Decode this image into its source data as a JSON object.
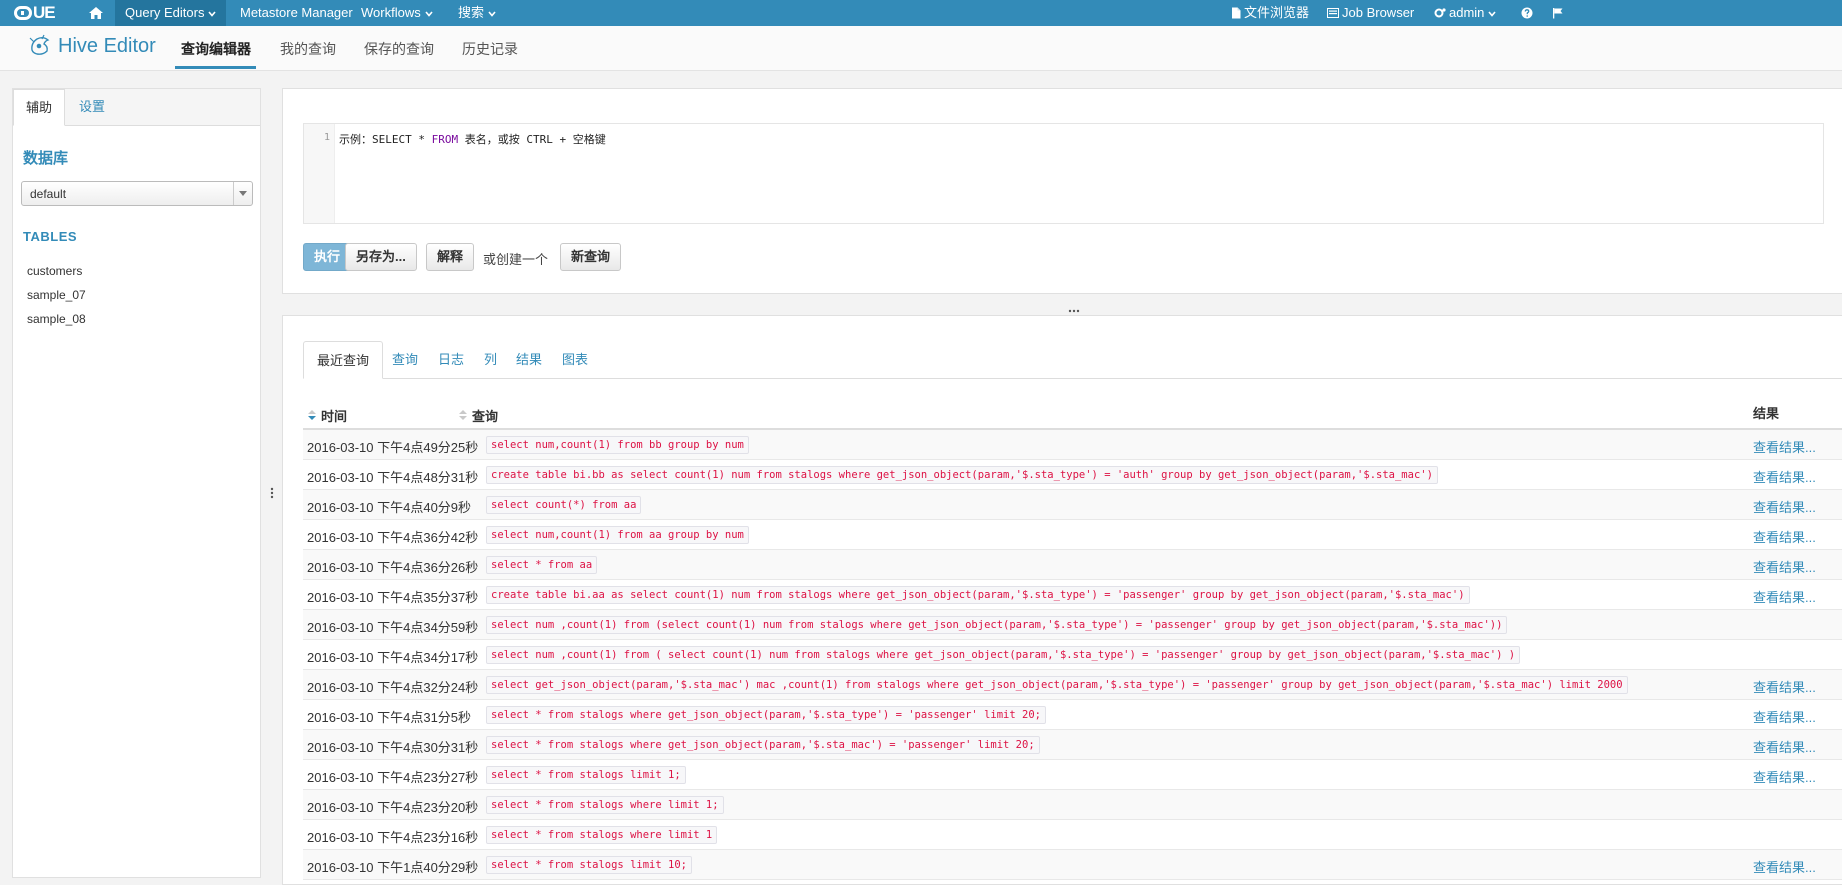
{
  "topnav": {
    "logo_text": "UE",
    "items": [
      {
        "label": "Query Editors"
      },
      {
        "label": "Metastore Manager"
      },
      {
        "label": "Workflows"
      },
      {
        "label": "搜索"
      }
    ],
    "right_items": [
      {
        "label": "文件浏览器"
      },
      {
        "label": "Job Browser"
      },
      {
        "label": "admin"
      }
    ]
  },
  "subheader": {
    "app_title": "Hive Editor",
    "tabs": [
      {
        "label": "查询编辑器"
      },
      {
        "label": "我的查询"
      },
      {
        "label": "保存的查询"
      },
      {
        "label": "历史记录"
      }
    ]
  },
  "left_panel": {
    "tabs": [
      {
        "label": "辅助"
      },
      {
        "label": "设置"
      }
    ],
    "database_label": "数据库",
    "database_selected": "default",
    "tables_label": "TABLES",
    "tables": [
      "customers",
      "sample_07",
      "sample_08"
    ]
  },
  "editor": {
    "line_number": "1",
    "code_prefix": "示例：SELECT * ",
    "code_keyword": "FROM",
    "code_suffix": " 表名，或按 CTRL + 空格键",
    "buttons": {
      "execute": "执行",
      "save_as": "另存为...",
      "explain": "解释",
      "or_create": "或创建一个",
      "new_query": "新查询"
    }
  },
  "results": {
    "tabs": [
      {
        "label": "最近查询"
      },
      {
        "label": "查询"
      },
      {
        "label": "日志"
      },
      {
        "label": "列"
      },
      {
        "label": "结果"
      },
      {
        "label": "图表"
      }
    ],
    "columns": {
      "time": "时间",
      "query": "查询",
      "result": "结果"
    },
    "rows": [
      {
        "time": "2016-03-10 下午4点49分25秒",
        "query": "select num,count(1) from bb group by num",
        "result": "查看结果..."
      },
      {
        "time": "2016-03-10 下午4点48分31秒",
        "query": "create table bi.bb as select count(1) num from stalogs where get_json_object(param,'$.sta_type') = 'auth' group by get_json_object(param,'$.sta_mac')",
        "result": "查看结果..."
      },
      {
        "time": "2016-03-10 下午4点40分9秒",
        "query": "select count(*) from aa",
        "result": "查看结果..."
      },
      {
        "time": "2016-03-10 下午4点36分42秒",
        "query": "select num,count(1) from aa group by num",
        "result": "查看结果..."
      },
      {
        "time": "2016-03-10 下午4点36分26秒",
        "query": "select * from aa",
        "result": "查看结果..."
      },
      {
        "time": "2016-03-10 下午4点35分37秒",
        "query": "create table bi.aa as select count(1) num from stalogs where get_json_object(param,'$.sta_type') = 'passenger' group by get_json_object(param,'$.sta_mac')",
        "result": "查看结果..."
      },
      {
        "time": "2016-03-10 下午4点34分59秒",
        "query": "select num ,count(1) from (select count(1) num from stalogs where get_json_object(param,'$.sta_type') = 'passenger' group by get_json_object(param,'$.sta_mac'))",
        "result": ""
      },
      {
        "time": "2016-03-10 下午4点34分17秒",
        "query": "select num ,count(1) from ( select count(1) num from stalogs where get_json_object(param,'$.sta_type') = 'passenger' group by get_json_object(param,'$.sta_mac') )",
        "result": ""
      },
      {
        "time": "2016-03-10 下午4点32分24秒",
        "query": "select get_json_object(param,'$.sta_mac') mac ,count(1) from stalogs where get_json_object(param,'$.sta_type') = 'passenger' group by get_json_object(param,'$.sta_mac') limit 2000",
        "result": "查看结果..."
      },
      {
        "time": "2016-03-10 下午4点31分5秒",
        "query": "select * from stalogs where get_json_object(param,'$.sta_type') = 'passenger' limit 20;",
        "result": "查看结果..."
      },
      {
        "time": "2016-03-10 下午4点30分31秒",
        "query": "select * from stalogs where get_json_object(param,'$.sta_mac') = 'passenger' limit 20;",
        "result": "查看结果..."
      },
      {
        "time": "2016-03-10 下午4点23分27秒",
        "query": "select * from stalogs limit 1;",
        "result": "查看结果..."
      },
      {
        "time": "2016-03-10 下午4点23分20秒",
        "query": "select * from stalogs where limit 1;",
        "result": ""
      },
      {
        "time": "2016-03-10 下午4点23分16秒",
        "query": "select * from stalogs where limit 1",
        "result": ""
      },
      {
        "time": "2016-03-10 下午1点40分29秒",
        "query": "select * from stalogs limit 10;",
        "result": "查看结果..."
      }
    ]
  },
  "icons": {
    "home": "home-icon",
    "file": "file-icon",
    "job": "list-icon",
    "user": "gears-icon",
    "help": "question-icon",
    "flag": "flag-icon"
  },
  "colors": {
    "navbar": "#338bb8",
    "link": "#338bb8",
    "query_text": "#dd1144",
    "primary_button": "#7eb6d7"
  }
}
